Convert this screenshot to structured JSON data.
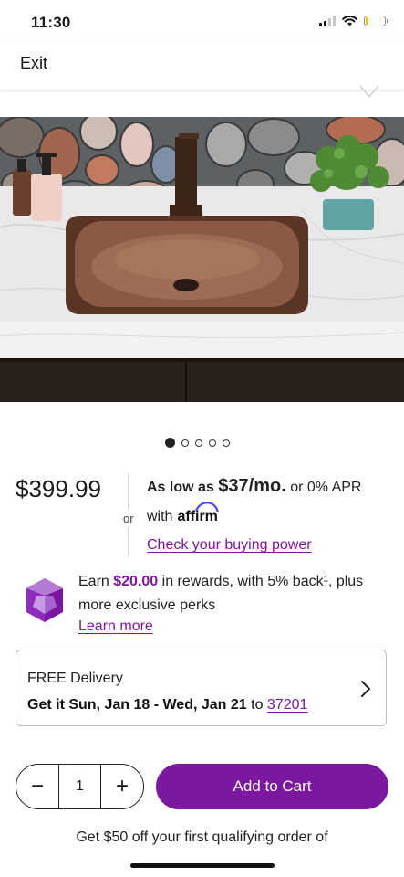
{
  "status_bar": {
    "time": "11:30"
  },
  "header": {
    "exit_label": "Exit"
  },
  "product": {
    "image": "copper-undermount-bathroom-sink-photo",
    "carousel": {
      "total": 5,
      "active": 1
    },
    "price": "$399.99"
  },
  "financing": {
    "as_low_as": "As low as",
    "monthly": "$37/mo.",
    "apr": "or 0% APR",
    "or": "or",
    "with": "with",
    "affirm": "affirm",
    "buying_power_link": "Check your buying power"
  },
  "rewards": {
    "earn": "Earn",
    "amount": "$20.00",
    "text": "in rewards, with 5% back¹, plus more exclusive perks",
    "learn_more": "Learn more"
  },
  "delivery": {
    "title": "FREE Delivery",
    "date_text": "Get it Sun, Jan 18 - Wed, Jan 21",
    "to": "to",
    "zip": "37201"
  },
  "cart": {
    "quantity": "1",
    "minus": "−",
    "plus": "+",
    "add_label": "Add to Cart"
  },
  "promo": {
    "text": "Get $50 off your first qualifying order of"
  },
  "colors": {
    "brand": "#7b189f",
    "text": "#1a1a1a"
  },
  "icons": [
    "signal-icon",
    "wifi-icon",
    "battery-icon",
    "heart-outline-icon",
    "gem-icon",
    "chevron-right-icon"
  ]
}
